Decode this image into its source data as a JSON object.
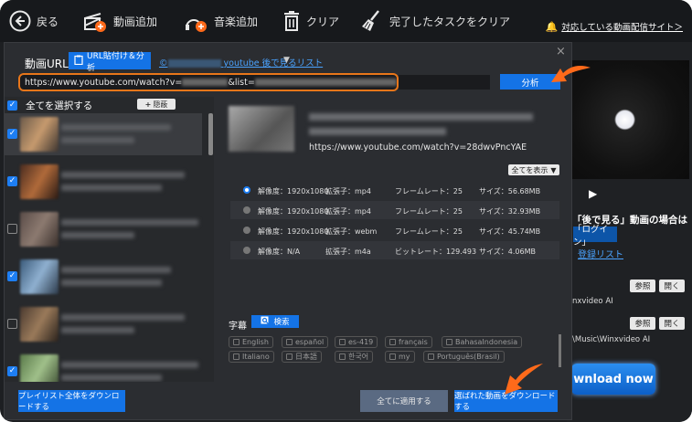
{
  "toolbar": {
    "back": "戻る",
    "add_video": "動画追加",
    "add_music": "音楽追加",
    "clear": "クリア",
    "clear_done": "完了したタスクをクリア",
    "supported_sites": "対応している動画配信サイト＞"
  },
  "dialog": {
    "url_label": "動画URL:",
    "paste_button": "URL貼付け＆分析",
    "youtube_watch_later": "youtube 後で見るリスト",
    "url_value_prefix": "https://www.youtube.com/watch?v=",
    "url_value_mid": "&list=",
    "analyze_button": "分析",
    "close_icon": "×"
  },
  "list": {
    "select_all": "全てを選択する",
    "collapse_button": "隠蔽",
    "items": [
      {
        "checked": true,
        "selected": true
      },
      {
        "checked": true,
        "selected": false
      },
      {
        "checked": false,
        "selected": false
      },
      {
        "checked": true,
        "selected": false
      },
      {
        "checked": false,
        "selected": false
      },
      {
        "checked": true,
        "selected": false
      }
    ]
  },
  "detail": {
    "video_url": "https://www.youtube.com/watch?v=28dwvPncYAE",
    "show_all": "全てを表示",
    "formats": [
      {
        "col1": "解像度：1920x1080",
        "col2": "拡張子：mp4",
        "col3": "フレームレート：25",
        "col4": "サイズ：56.68MB",
        "selected": true
      },
      {
        "col1": "解像度：1920x1080",
        "col2": "拡張子：mp4",
        "col3": "フレームレート：25",
        "col4": "サイズ：32.93MB",
        "selected": false
      },
      {
        "col1": "解像度：1920x1080",
        "col2": "拡張子：webm",
        "col3": "フレームレート：25",
        "col4": "サイズ：45.74MB",
        "selected": false
      },
      {
        "col1": "解像度：N/A",
        "col2": "拡張子：m4a",
        "col3": "ビットレート：129.493",
        "col4": "サイズ：4.06MB",
        "selected": false
      }
    ],
    "subtitles_label": "字幕",
    "search_button": "検索",
    "languages_row1": [
      "English",
      "español",
      "es-419",
      "français",
      "BahasaIndonesia"
    ],
    "languages_row2": [
      "Italiano",
      "日本語",
      "한국어",
      "my",
      "Português(Brasil)"
    ]
  },
  "bottom": {
    "download_playlist": "プレイリスト全体をダウンロードする",
    "apply_all": "全てに適用する",
    "download_selected": "選ばれた動画をダウンロードする"
  },
  "background_panel": {
    "watch_later_heading": "「後で見る」動画の場合は",
    "login_button": "「ログイン」",
    "register_list": "登録リスト",
    "browse_button": "参照",
    "open_button": "開く",
    "path1": "nxvideo AI",
    "path2": "\\Music\\Winxvideo AI",
    "download_now": "wnload now"
  },
  "colors": {
    "accent": "#1473e6",
    "highlight_orange": "#e8761a",
    "background": "#1d1f22"
  }
}
